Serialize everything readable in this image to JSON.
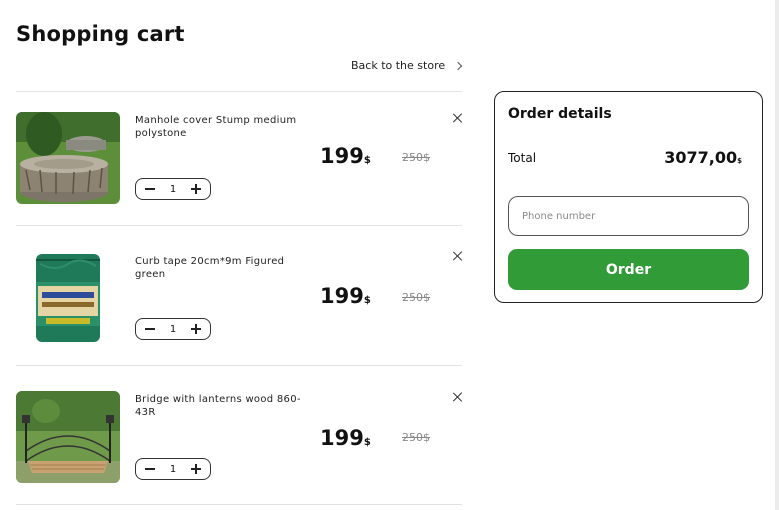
{
  "page": {
    "title": "Shopping cart",
    "back_link": "Back to the store"
  },
  "cart": {
    "items": [
      {
        "name": "Manhole cover Stump medium polystone",
        "quantity": "1",
        "price": "199",
        "currency": "$",
        "old_price": "250$",
        "image": "stump-cover-photo"
      },
      {
        "name": "Curb tape 20cm*9m Figured green",
        "quantity": "1",
        "price": "199",
        "currency": "$",
        "old_price": "250$",
        "image": "curb-tape-photo"
      },
      {
        "name": "Bridge with lanterns wood 860-43R",
        "quantity": "1",
        "price": "199",
        "currency": "$",
        "old_price": "250$",
        "image": "bridge-photo"
      }
    ]
  },
  "order": {
    "title": "Order details",
    "total_label": "Total",
    "total_value": "3077,00",
    "total_currency": "$",
    "phone_placeholder": "Phone number",
    "order_button": "Order"
  },
  "colors": {
    "accent": "#319b38",
    "text": "#111111",
    "muted": "#888888"
  }
}
